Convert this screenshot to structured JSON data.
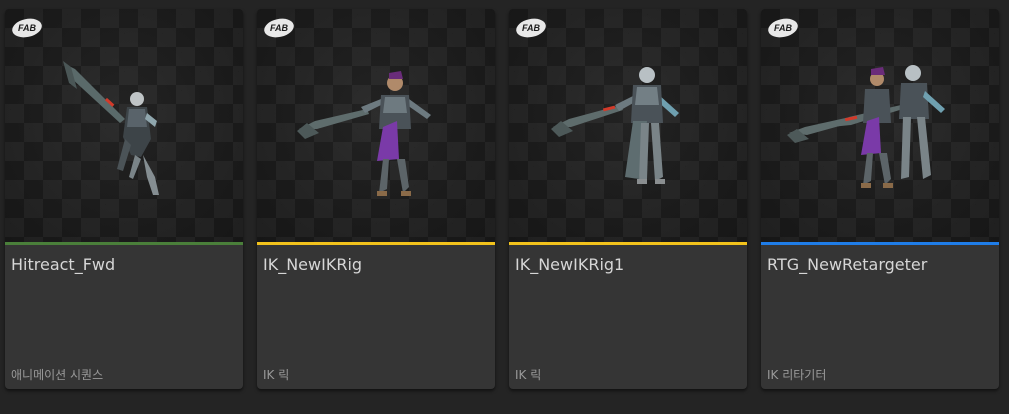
{
  "badge_text": "FAB",
  "cards": [
    {
      "name": "Hitreact_Fwd",
      "type": "애니메이션 시퀀스",
      "type_color": "#4a7f3a"
    },
    {
      "name": "IK_NewIKRig",
      "type": "IK 릭",
      "type_color": "#f2c21c"
    },
    {
      "name": "IK_NewIKRig1",
      "type": "IK 릭",
      "type_color": "#f2c21c"
    },
    {
      "name": "RTG_NewRetargeter",
      "type": "IK 리타기터",
      "type_color": "#1f7de8"
    }
  ]
}
